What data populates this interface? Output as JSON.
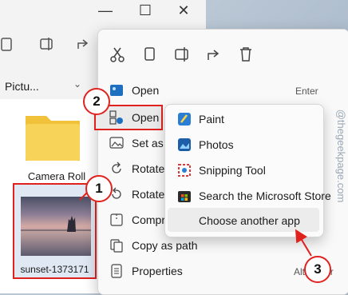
{
  "explorer": {
    "window_controls": [
      "—",
      "☐",
      "✕"
    ],
    "breadcrumb": "Pictu...",
    "folder_label": "Camera Roll",
    "image_label": "sunset-1373171"
  },
  "context_menu": {
    "toolbar_icons": [
      "scissors-icon",
      "copy-icon",
      "rename-icon",
      "share-icon",
      "delete-icon"
    ],
    "items": [
      {
        "label": "Open",
        "shortcut": "Enter"
      },
      {
        "label": "Open",
        "shortcut": ""
      },
      {
        "label": "Set as",
        "shortcut": ""
      },
      {
        "label": "Rotate",
        "shortcut": ""
      },
      {
        "label": "Rotate",
        "shortcut": ""
      },
      {
        "label": "Compr",
        "shortcut": ""
      },
      {
        "label": "Copy as path",
        "shortcut": ""
      },
      {
        "label": "Properties",
        "shortcut": "Alt+Enter"
      }
    ]
  },
  "open_with_submenu": {
    "items": [
      "Paint",
      "Photos",
      "Snipping Tool",
      "Search the Microsoft Store",
      "Choose another app"
    ]
  },
  "callouts": [
    "1",
    "2",
    "3"
  ],
  "watermark": "@thegeekpage.com",
  "colors": {
    "accent_red": "#e0221f",
    "menu_bg": "#f9f9f9"
  }
}
